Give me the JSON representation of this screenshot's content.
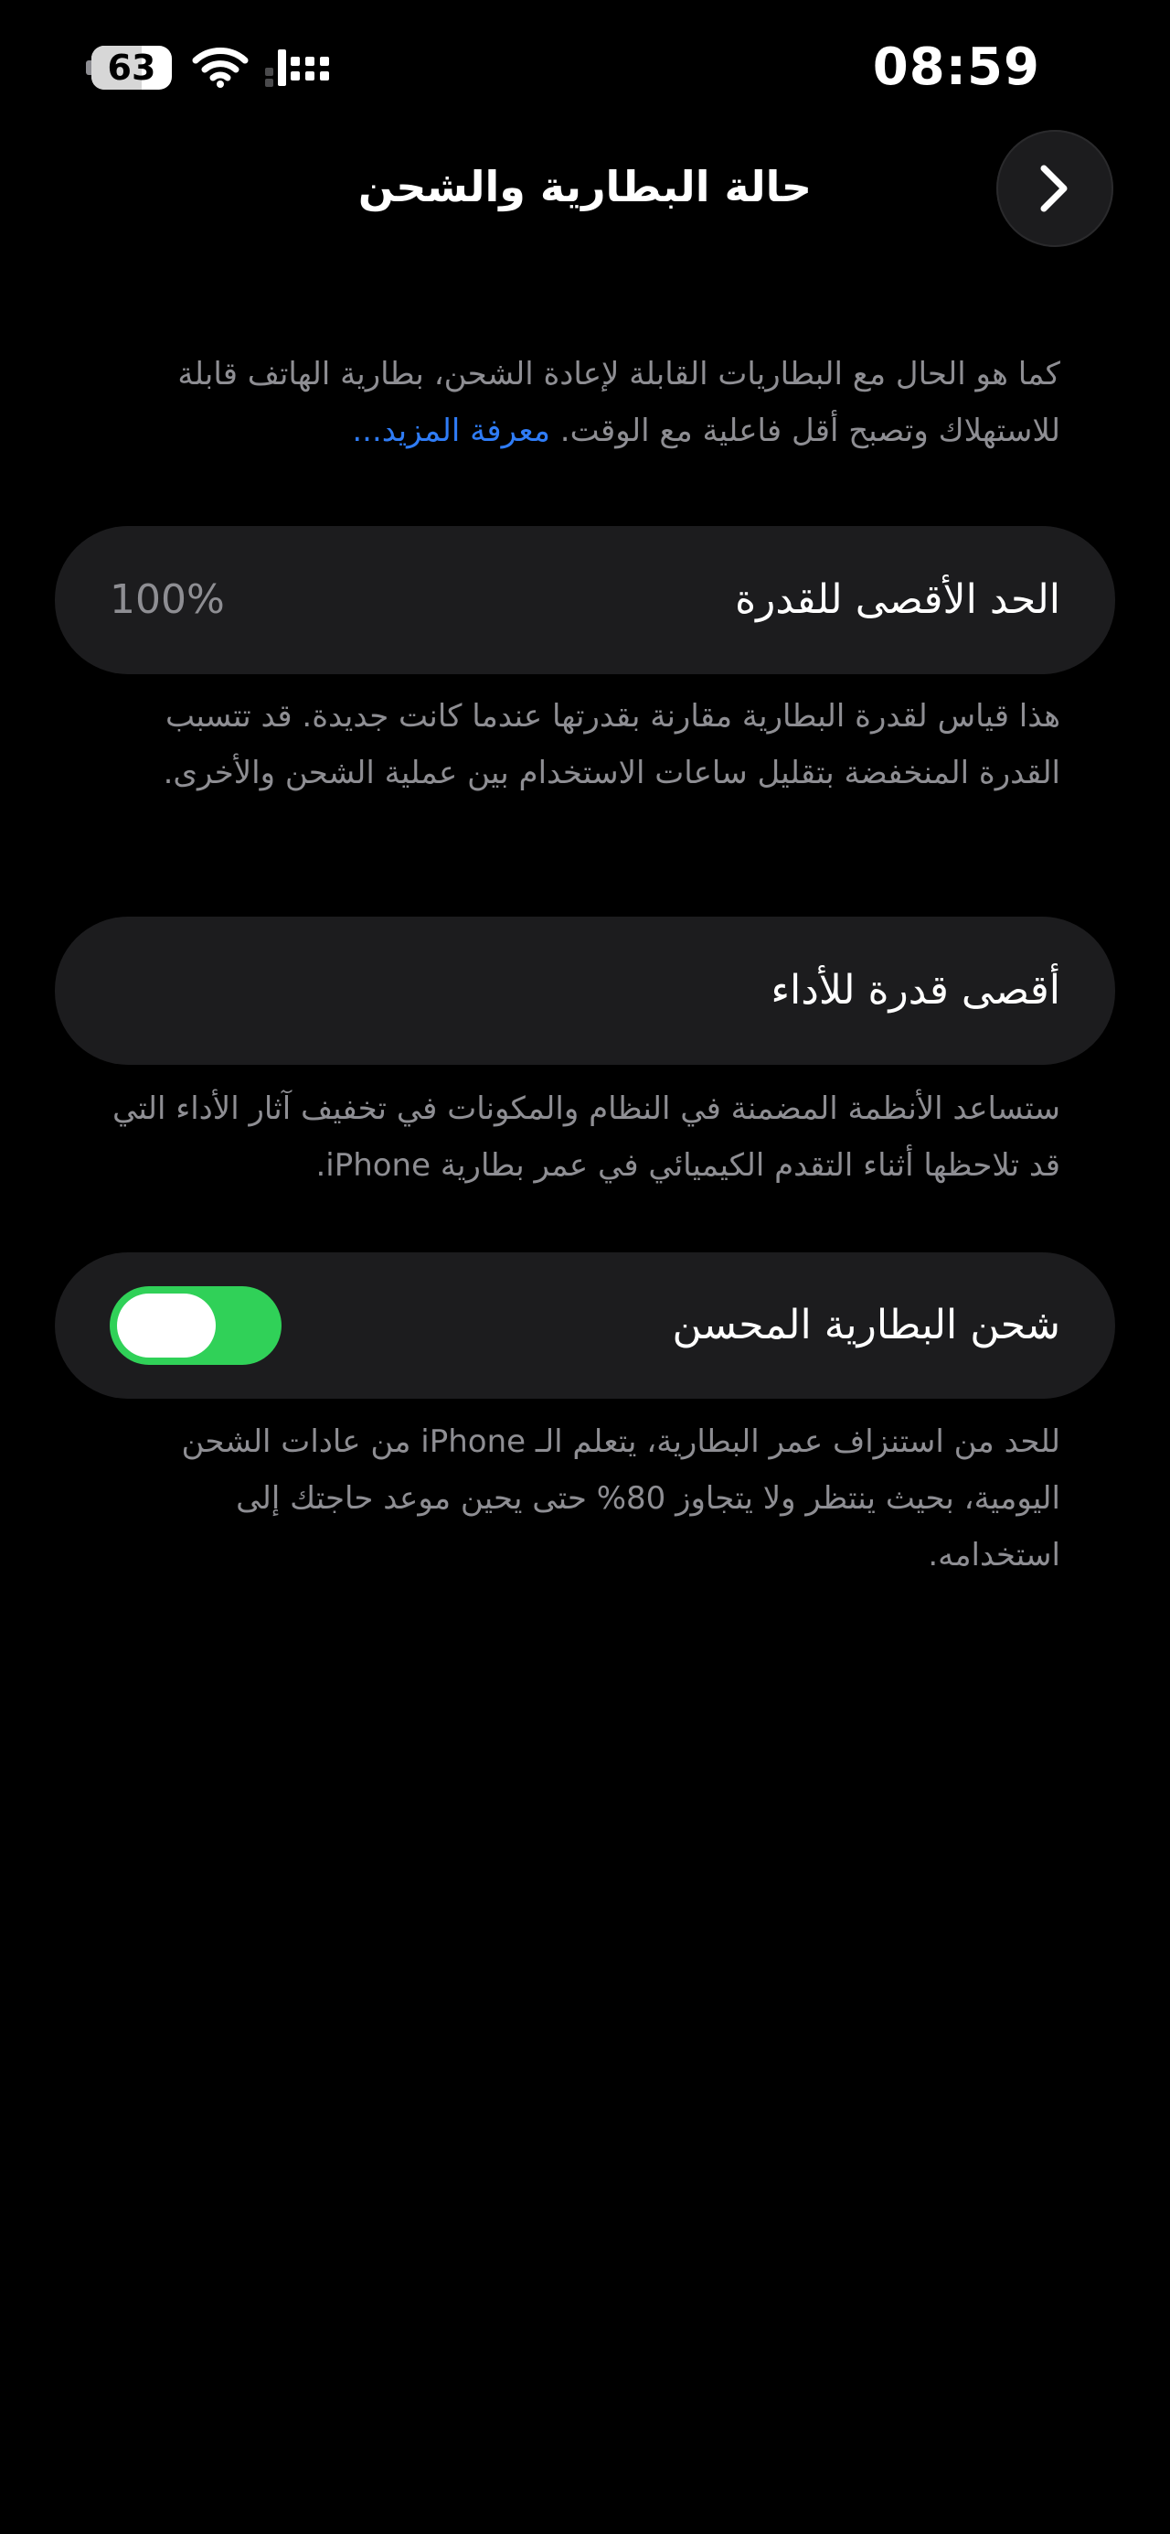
{
  "status_bar": {
    "time": "08:59",
    "battery_level": 63,
    "icons": [
      "battery-icon",
      "wifi-icon",
      "cellular-signal-icon"
    ]
  },
  "nav": {
    "title": "حالة البطارية والشحن",
    "back_icon": "chevron-right-icon"
  },
  "intro": {
    "text": "كما هو الحال مع البطاريات القابلة لإعادة الشحن، بطارية الهاتف قابلة للاستهلاك وتصبح أقل فاعلية مع الوقت.",
    "learn_more": "معرفة المزيد..."
  },
  "maximum_capacity": {
    "label": "الحد الأقصى للقدرة",
    "value": "100%",
    "footer": "هذا قياس لقدرة البطارية مقارنة بقدرتها عندما كانت جديدة. قد تتسبب القدرة المنخفضة بتقليل ساعات الاستخدام بين عملية الشحن والأخرى."
  },
  "peak_performance": {
    "label": "أقصى قدرة للأداء",
    "footer": "ستساعد الأنظمة المضمنة في النظام والمكونات في تخفيف آثار الأداء التي قد تلاحظها أثناء التقدم الكيميائي في عمر بطارية iPhone."
  },
  "optimized_charging": {
    "label": "شحن البطارية المحسن",
    "enabled": true,
    "footer": "للحد من استنزاف عمر البطارية، يتعلم الـ iPhone من عادات الشحن اليومية، بحيث ينتظر ولا يتجاوز 80% حتى يحين موعد حاجتك إلى استخدامه."
  },
  "colors": {
    "background": "#000000",
    "cell": "#1c1c1e",
    "secondary_text": "#8e8e93",
    "link": "#2f7cf6",
    "toggle_on": "#30d158"
  }
}
